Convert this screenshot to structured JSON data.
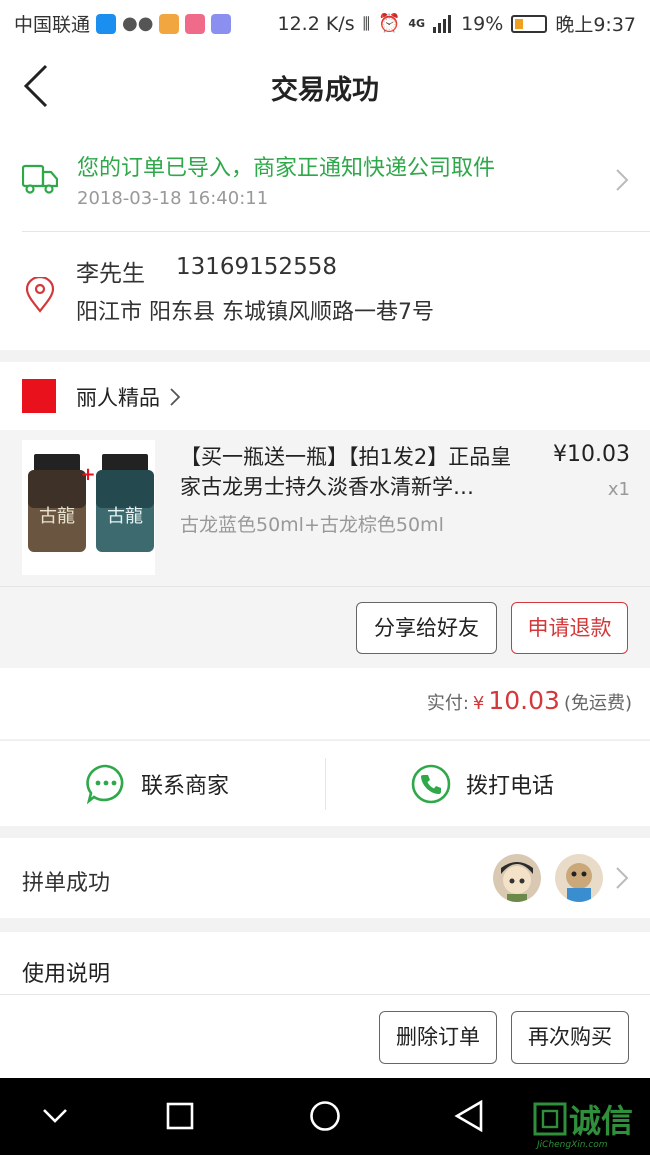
{
  "status_bar": {
    "carrier": "中国联通",
    "speed": "12.2 K/s",
    "network": "4G",
    "battery": "19%",
    "time": "晚上9:37"
  },
  "header": {
    "title": "交易成功"
  },
  "logistics": {
    "message": "您的订单已导入，商家正通知快递公司取件",
    "time": "2018-03-18 16:40:11"
  },
  "receiver": {
    "name": "李先生",
    "phone": "13169152558",
    "address": "阳江市 阳东县 东城镇风顺路一巷7号"
  },
  "shop": {
    "name": "丽人精品",
    "logo_text": "丽人精品"
  },
  "product": {
    "title": "【买一瓶送一瓶】【拍1发2】正品皇家古龙男士持久淡香水清新学…",
    "price": "¥10.03",
    "quantity": "x1",
    "spec": "古龙蓝色50ml+古龙棕色50ml",
    "image_labels": [
      "古龍",
      "古龍"
    ],
    "share_button": "分享给好友",
    "refund_button": "申请退款"
  },
  "payment": {
    "label": "实付:",
    "currency": "¥",
    "amount": "10.03",
    "note": "(免运费)"
  },
  "contact": {
    "merchant_label": "联系商家",
    "call_label": "拨打电话"
  },
  "group": {
    "label": "拼单成功"
  },
  "instructions": {
    "label": "使用说明"
  },
  "actions": {
    "delete_label": "删除订单",
    "rebuy_label": "再次购买"
  },
  "watermark": {
    "text": "诚信",
    "sub": "JiChengXin.com"
  },
  "colors": {
    "accent_green": "#2fa84a",
    "accent_red": "#d3393b",
    "shop_red": "#e8111c"
  }
}
